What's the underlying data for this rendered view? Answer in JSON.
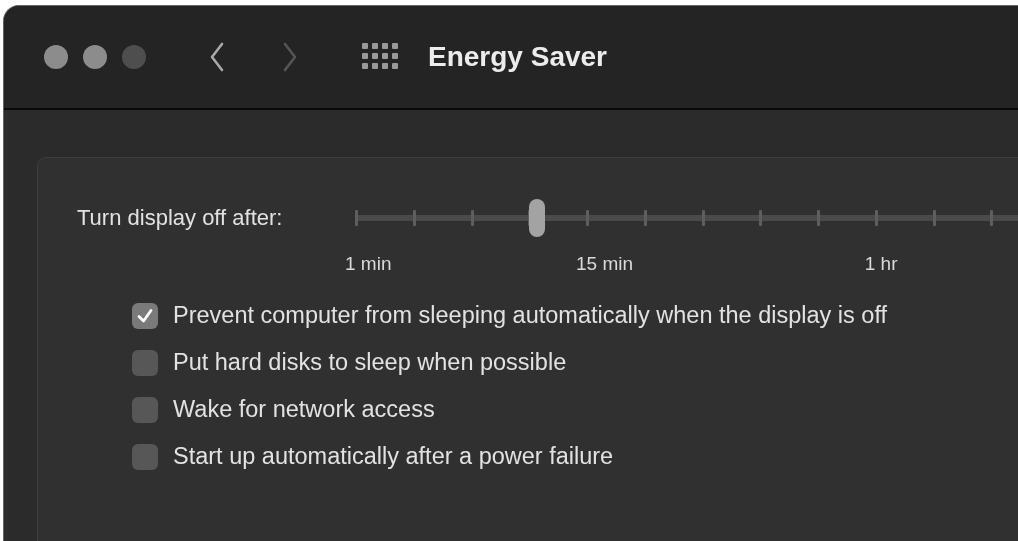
{
  "window": {
    "title": "Energy Saver"
  },
  "navigation": {
    "back": {
      "disabled": false
    },
    "forward": {
      "disabled": true
    }
  },
  "display_sleep": {
    "label": "Turn display off after:",
    "level": 0.26,
    "tick_labels": [
      "1 min",
      "15 min",
      "1 hr"
    ]
  },
  "options": [
    {
      "label": "Prevent computer from sleeping automatically when the display is off",
      "checked": true
    },
    {
      "label": "Put hard disks to sleep when possible",
      "checked": false
    },
    {
      "label": "Wake for network access",
      "checked": false
    },
    {
      "label": "Start up automatically after a power failure",
      "checked": false
    }
  ]
}
